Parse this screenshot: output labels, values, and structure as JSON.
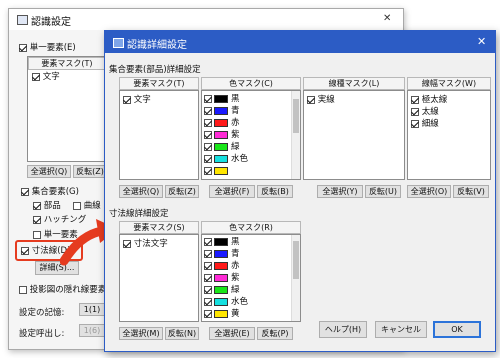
{
  "back_dialog": {
    "title": "認識設定",
    "close_glyph": "✕",
    "single_element_label": "単一要素(E)",
    "element_mask_header": "要素マスク(T)",
    "element_item": "文字",
    "select_all_label": "全選択(Q)",
    "invert_label": "反転(Z)",
    "group_element_label": "集合要素(G)",
    "part_label": "部品",
    "curve_label": "曲線",
    "hatching_label": "ハッチング",
    "single_element_partial": "単一要素",
    "dimension_label": "寸法線(D)",
    "detail_button": "詳細(S)...",
    "projection_label": "投影図の隠れ線要素",
    "settings_memory_label": "設定の記憶:",
    "settings_recall_label": "設定呼出し:",
    "memory_slot": "1(1)",
    "recall_slot": "1(6)"
  },
  "dialog": {
    "title": "認識詳細設定",
    "close_glyph": "✕",
    "group_section_title": "集合要素(部品)詳細設定",
    "dimension_section_title": "寸法線詳細設定",
    "group": {
      "element_mask_header": "要素マスク(T)",
      "color_mask_header": "色マスク(C)",
      "line_type_header": "線種マスク(L)",
      "line_width_header": "線幅マスク(W)",
      "element_items": [
        "文字"
      ],
      "line_type_items": [
        "実線"
      ],
      "line_width_items": [
        "極太線",
        "太線",
        "細線"
      ],
      "colors": [
        {
          "label": "黒",
          "color": "#000000"
        },
        {
          "label": "青",
          "color": "#1a1aff"
        },
        {
          "label": "赤",
          "color": "#ff1a1a"
        },
        {
          "label": "紫",
          "color": "#ff2bd6"
        },
        {
          "label": "緑",
          "color": "#19e619"
        },
        {
          "label": "水色",
          "color": "#16e0e0"
        }
      ],
      "buttons": {
        "element_select_all": "全選択(Q)",
        "element_invert": "反転(Z)",
        "color_select_all": "全選択(F)",
        "color_invert": "反転(B)",
        "line_type_select_all": "全選択(Y)",
        "line_type_invert": "反転(U)",
        "line_width_select_all": "全選択(O)",
        "line_width_invert": "反転(V)"
      }
    },
    "dimension": {
      "element_mask_header": "要素マスク(S)",
      "color_mask_header": "色マスク(R)",
      "element_items": [
        "寸法文字"
      ],
      "colors": [
        {
          "label": "黒",
          "color": "#000000"
        },
        {
          "label": "青",
          "color": "#1a1aff"
        },
        {
          "label": "赤",
          "color": "#ff1a1a"
        },
        {
          "label": "紫",
          "color": "#ff2bd6"
        },
        {
          "label": "緑",
          "color": "#19e619"
        },
        {
          "label": "水色",
          "color": "#16e0e0"
        },
        {
          "label": "黄",
          "color": "#ffe600"
        }
      ],
      "buttons": {
        "element_select_all": "全選択(M)",
        "element_invert": "反転(N)",
        "color_select_all": "全選択(E)",
        "color_invert": "反転(P)"
      }
    },
    "help_button": "ヘルプ(H)",
    "cancel_button": "キャンセル",
    "ok_button": "OK"
  },
  "colors": {
    "dialog_frame": "#2c5cc5",
    "highlight": "#e53b1f"
  }
}
